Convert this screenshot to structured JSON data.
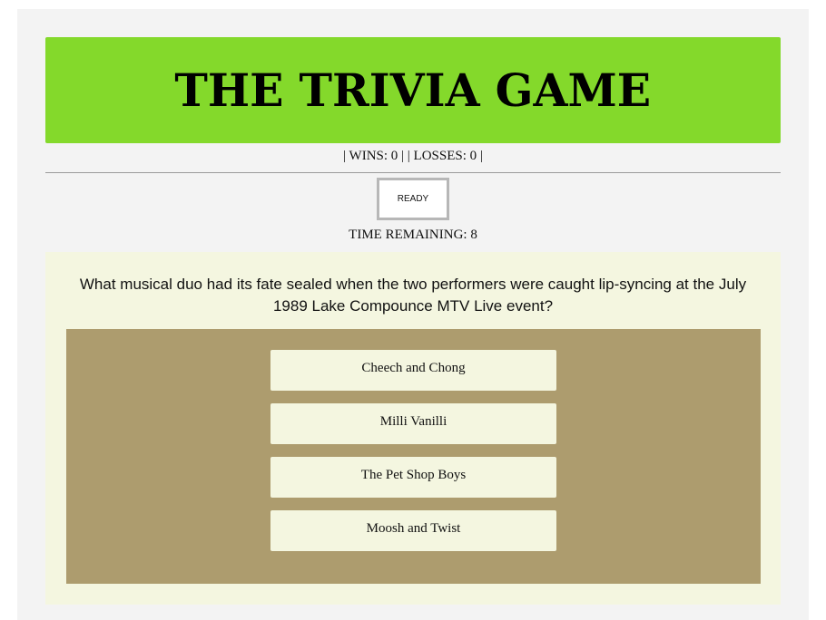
{
  "header": {
    "title": "THE TRIVIA GAME"
  },
  "score": {
    "text": "| WINS: 0 | | LOSSES: 0 |"
  },
  "ready_button": {
    "label": "READY"
  },
  "timer": {
    "text": "TIME REMAINING: 8"
  },
  "question": {
    "text": "What musical duo had its fate sealed when the two performers were caught lip-syncing at the July 1989 Lake Compounce MTV Live event?"
  },
  "answers": [
    {
      "label": "Cheech and Chong"
    },
    {
      "label": "Milli Vanilli"
    },
    {
      "label": "The Pet Shop Boys"
    },
    {
      "label": "Moosh and Twist"
    }
  ],
  "colors": {
    "header_bg": "#84d92b",
    "page_bg": "#f3f3f3",
    "panel_bg": "#f4f6e0",
    "answers_bg": "#ad9c6e"
  }
}
